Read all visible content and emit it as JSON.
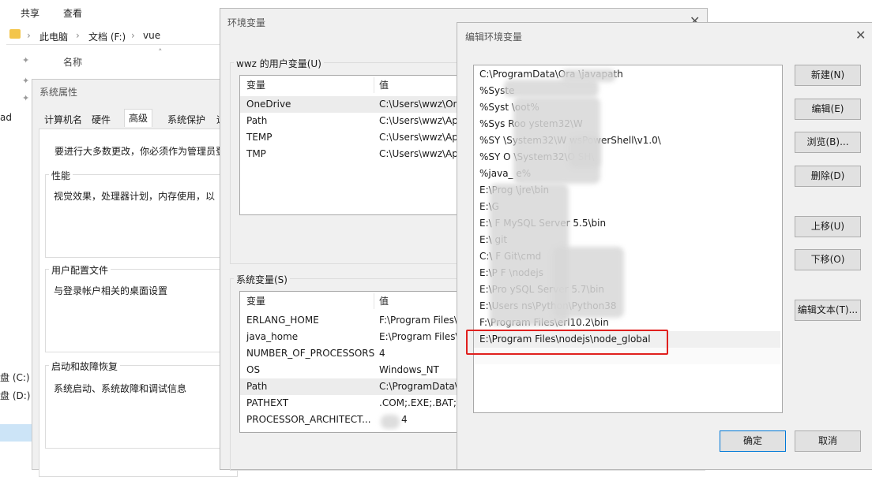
{
  "explorer": {
    "ribbon_tabs": [
      "共享",
      "查看"
    ],
    "breadcrumb": [
      "此电脑",
      "文档 (F:)",
      "vue"
    ],
    "column_name": "名称",
    "side_labels": [
      "ad",
      "盘 (C:)",
      "盘 (D:)"
    ]
  },
  "sysprops": {
    "title": "系统属性",
    "tabs": [
      "计算机名",
      "硬件",
      "高级",
      "系统保护",
      "远"
    ],
    "admin_note": "要进行大多数更改，你必须作为管理员登",
    "performance": {
      "title": "性能",
      "desc": "视觉效果，处理器计划，内存使用，以"
    },
    "profiles": {
      "title": "用户配置文件",
      "desc": "与登录帐户相关的桌面设置"
    },
    "startup": {
      "title": "启动和故障恢复",
      "desc": "系统启动、系统故障和调试信息"
    }
  },
  "envdlg": {
    "title": "环境变量",
    "user_section": "wwz 的用户变量(U)",
    "col_var": "变量",
    "col_val": "值",
    "user_vars": [
      {
        "name": "OneDrive",
        "value": "C:\\Users\\wwz\\On"
      },
      {
        "name": "Path",
        "value": "C:\\Users\\wwz\\App"
      },
      {
        "name": "TEMP",
        "value": "C:\\Users\\wwz\\App"
      },
      {
        "name": "TMP",
        "value": "C:\\Users\\wwz\\App"
      }
    ],
    "sys_section": "系统变量(S)",
    "sys_vars": [
      {
        "name": "ERLANG_HOME",
        "value": "F:\\Program Files\\"
      },
      {
        "name": "java_home",
        "value": "E:\\Program Files\\"
      },
      {
        "name": "NUMBER_OF_PROCESSORS",
        "value": "4"
      },
      {
        "name": "OS",
        "value": "Windows_NT"
      },
      {
        "name": "Path",
        "value": "C:\\ProgramData\\"
      },
      {
        "name": "PATHEXT",
        "value": ".COM;.EXE;.BAT;.C"
      },
      {
        "name": "PROCESSOR_ARCHITECT...",
        "value": "4"
      }
    ]
  },
  "editdlg": {
    "title": "编辑环境变量",
    "entries": [
      "C:\\ProgramData\\Ora            \\javapath",
      "%Syste",
      "%Syst    \\oot%",
      "%Sys     Roo    ystem32\\W",
      "%SY                    \\System32\\W          wsPowerShell\\v1.0\\",
      "%SY               O      \\System32\\O        SH\\",
      "%java_       e%",
      "E:\\Prog                      \\jre\\bin",
      "E:\\G",
      "E:\\            F                  MySQL Server 5.5\\bin",
      "E:\\             git",
      "C:\\            F       Git\\cmd",
      "E:\\P            F      \\nodejs",
      "E:\\Pro                         ySQL Server 5.7\\bin",
      "E:\\Users                            ns\\Python\\Python38",
      "F:\\Program Files\\erl10.2\\bin",
      "E:\\Program Files\\nodejs\\node_global"
    ],
    "buttons": {
      "new": "新建(N)",
      "edit": "编辑(E)",
      "browse": "浏览(B)...",
      "delete": "删除(D)",
      "move_up": "上移(U)",
      "move_down": "下移(O)",
      "edit_text": "编辑文本(T)...",
      "ok": "确定",
      "cancel": "取消"
    }
  }
}
